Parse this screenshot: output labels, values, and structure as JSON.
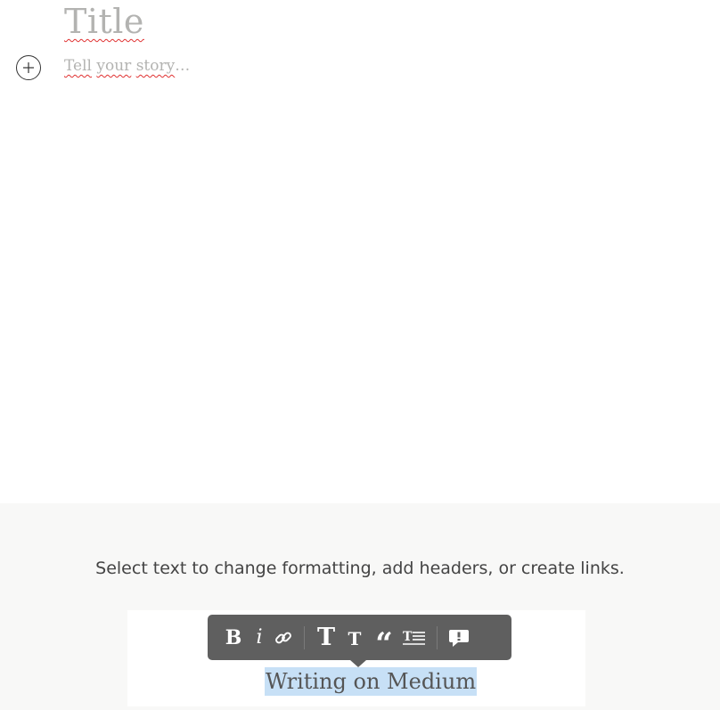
{
  "editor": {
    "title_placeholder": "Title",
    "story_placeholder_words": [
      "Tell",
      "your",
      "story",
      "…"
    ],
    "add_icon": "plus-circle-icon"
  },
  "help": {
    "instruction": "Select text to change formatting, add headers, or create links.",
    "demo_selected_text": "Writing on Medium",
    "toolbar": {
      "bold_label": "B",
      "italic_label": "i",
      "large_heading_label": "T",
      "small_heading_label": "T",
      "quote_label": "“",
      "link_icon": "link-icon",
      "text_list_icon": "text-list-icon",
      "comment_icon": "comment-icon"
    }
  },
  "colors": {
    "placeholder": "#b3b3b1",
    "toolbar_bg": "#5f5f5f",
    "selection": "#c7e0f6",
    "panel_bg": "#f8f8f7"
  }
}
